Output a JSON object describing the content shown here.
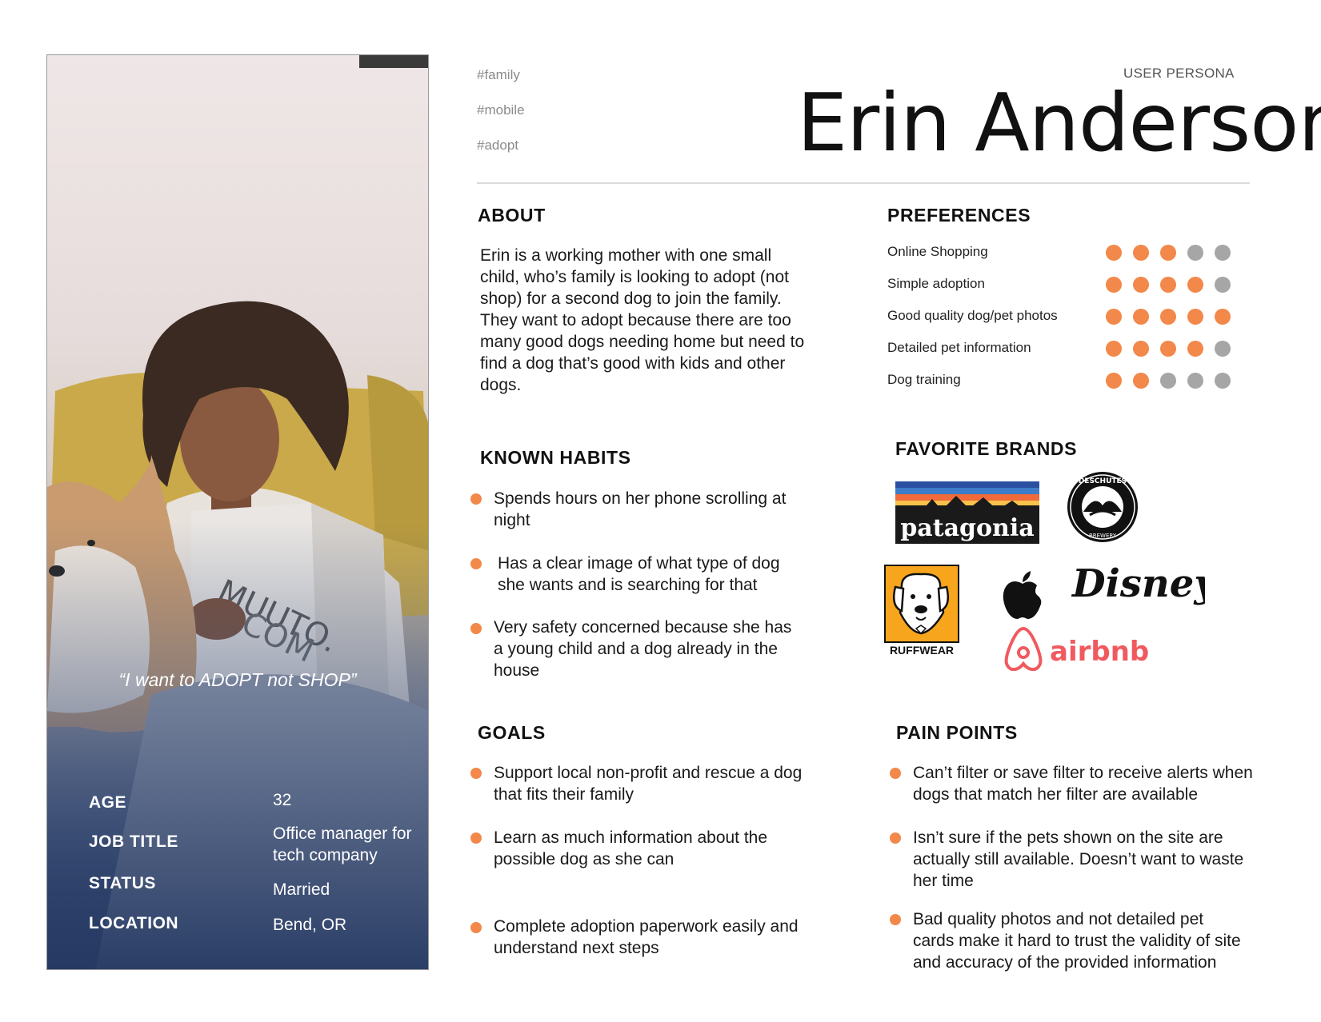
{
  "tags": [
    "#family",
    "#mobile",
    "#adopt"
  ],
  "persona_label": "USER PERSONA",
  "name": "Erin Anderson",
  "card": {
    "quote": "“I want to ADOPT not SHOP”",
    "facts": [
      {
        "key": "AGE",
        "value": "32"
      },
      {
        "key": "JOB TITLE",
        "value": "Office manager for tech company"
      },
      {
        "key": "STATUS",
        "value": "Married"
      },
      {
        "key": "LOCATION",
        "value": "Bend, OR"
      }
    ]
  },
  "about": {
    "title": "ABOUT",
    "text": "Erin is a working mother with one small child, who’s family is looking to adopt (not shop) for a second dog to join the family. They want to adopt because there are too many good dogs needing home but need to find a dog that’s good with kids and other dogs."
  },
  "preferences": {
    "title": "PREFERENCES",
    "max": 5,
    "items": [
      {
        "label": "Online Shopping",
        "rating": 3
      },
      {
        "label": "Simple adoption",
        "rating": 4
      },
      {
        "label": "Good quality dog/pet photos",
        "rating": 5
      },
      {
        "label": "Detailed pet information",
        "rating": 4
      },
      {
        "label": "Dog training",
        "rating": 2
      }
    ],
    "filled_color": "#f2884a",
    "empty_color": "#a6a6a6"
  },
  "habits": {
    "title": "KNOWN HABITS",
    "items": [
      "Spends hours on her phone scrolling at night",
      "Has a clear image of what type of dog she wants and is searching for that",
      "Very safety concerned because she has a young child and a dog already in the house"
    ]
  },
  "brands": {
    "title": "FAVORITE BRANDS",
    "logos": {
      "patagonia": "patagonia",
      "deschutes": "DESCHUTES",
      "deschutes_sub": "BREWERY",
      "ruffwear": "RUFFWEAR",
      "disney": "Disney",
      "airbnb": "airbnb"
    }
  },
  "goals": {
    "title": "GOALS",
    "items": [
      "Support local non-profit and rescue a dog that fits their family",
      "Learn as much information about the possible dog as she can",
      "Complete adoption paperwork easily and understand next steps"
    ]
  },
  "pain_points": {
    "title": "PAIN POINTS",
    "items": [
      "Can’t filter or save filter to receive alerts when dogs that match her filter are available",
      "Isn’t sure if the pets shown on the site are actually still available. Doesn’t want to waste her time",
      "Bad quality photos and not detailed pet cards make it hard to trust the validity of site and accuracy of the provided information"
    ]
  },
  "accent_color": "#f2884a"
}
